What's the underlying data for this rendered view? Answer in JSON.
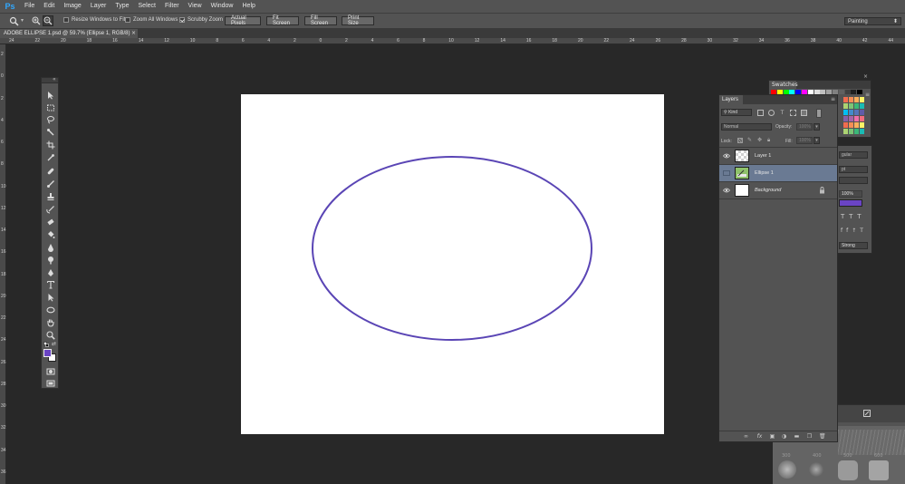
{
  "app": {
    "logo": "Ps"
  },
  "menu": [
    "File",
    "Edit",
    "Image",
    "Layer",
    "Type",
    "Select",
    "Filter",
    "View",
    "Window",
    "Help"
  ],
  "options_bar": {
    "resize_windows": "Resize Windows to Fit",
    "zoom_all": "Zoom All Windows",
    "scrubby_zoom": "Scrubby Zoom",
    "actual_pixels": "Actual Pixels",
    "fit_screen": "Fit Screen",
    "fill_screen": "Fill Screen",
    "print_size": "Print Size",
    "workspace": "Painting",
    "scrubby_checked": true
  },
  "document": {
    "tab_title": "ADOBE ELLIPSE 1.psd @ 59.7% (Ellipse 1, RGB/8)",
    "tab_close": "×",
    "ellipse_stroke_color": "#5a45b5"
  },
  "rulers": {
    "h_labels": [
      "24",
      "22",
      "20",
      "18",
      "16",
      "14",
      "12",
      "10",
      "8",
      "6",
      "4",
      "2",
      "0",
      "2",
      "4",
      "6",
      "8",
      "10",
      "12",
      "14",
      "16",
      "18",
      "20",
      "22",
      "24",
      "26",
      "28",
      "30",
      "32",
      "34",
      "36",
      "38",
      "40",
      "42",
      "44"
    ],
    "v_labels": [
      "2",
      "0",
      "2",
      "4",
      "6",
      "8",
      "10",
      "12",
      "14",
      "16",
      "18",
      "20",
      "22",
      "24",
      "26",
      "28",
      "30",
      "32",
      "34",
      "36"
    ]
  },
  "tools": {
    "foreground_color": "#6a44c4",
    "background_color": "#ffffff"
  },
  "swatches": {
    "tab": "Swatches"
  },
  "properties_partial": {
    "dropdown1": "gular",
    "unit": "pt",
    "percent": "100%",
    "fill_color": "#6a44c4",
    "aa": "Strong"
  },
  "layers": {
    "tab": "Layers",
    "filter_kind": "Kind",
    "blend_mode": "Normal",
    "opacity_label": "Opacity:",
    "opacity_value": "100%",
    "lock_label": "Lock:",
    "fill_label": "Fill:",
    "fill_value": "100%",
    "items": [
      {
        "name": "Layer 1",
        "visible": true,
        "selected": false
      },
      {
        "name": "Ellipse 1",
        "visible": false,
        "selected": true
      },
      {
        "name": "Background",
        "visible": true,
        "selected": false,
        "locked": true
      }
    ]
  },
  "brush_sizes": [
    "300",
    "400",
    "500",
    "600"
  ]
}
